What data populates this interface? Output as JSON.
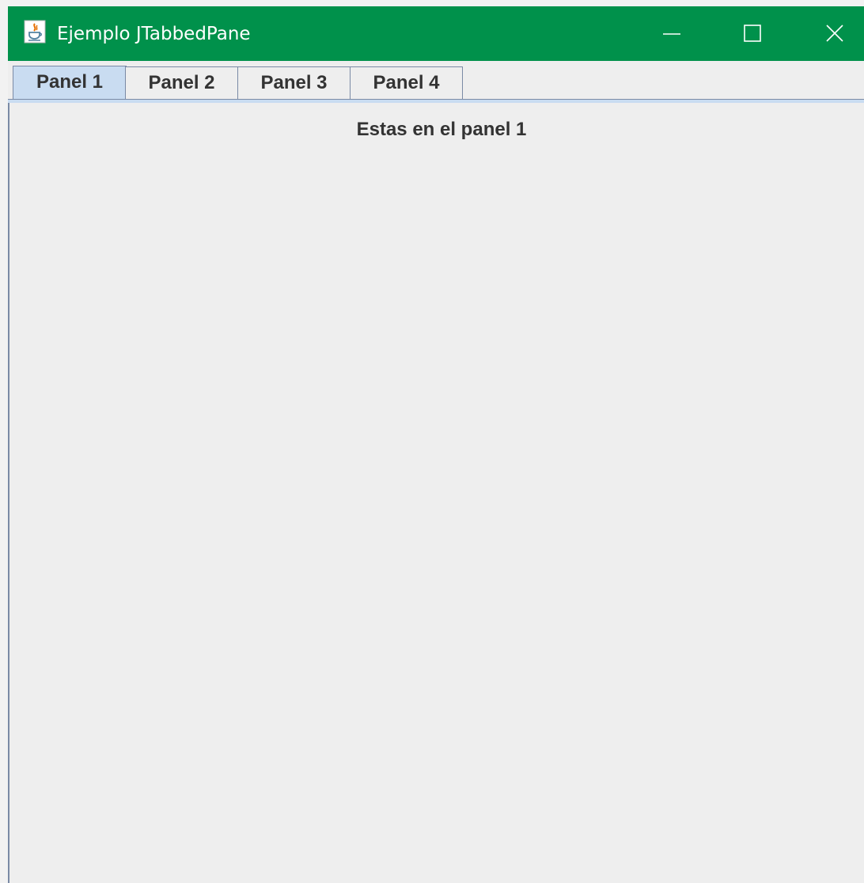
{
  "window": {
    "title": "Ejemplo JTabbedPane",
    "titlebar_color": "#00914b",
    "app_icon": "java-icon",
    "controls": [
      "minimize-icon",
      "maximize-icon",
      "close-icon"
    ]
  },
  "tabs": [
    {
      "label": "Panel 1",
      "selected": true
    },
    {
      "label": "Panel 2",
      "selected": false
    },
    {
      "label": "Panel 3",
      "selected": false
    },
    {
      "label": "Panel 4",
      "selected": false
    }
  ],
  "panel": {
    "text": "Estas en el panel 1"
  },
  "colors": {
    "selected_tab": "#c9dcf1",
    "border": "#7a8aa5",
    "background": "#eeeeee"
  }
}
